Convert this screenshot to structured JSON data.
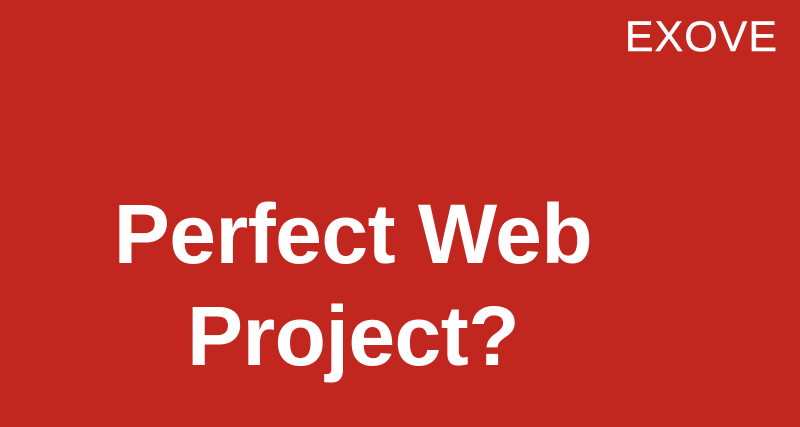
{
  "slide": {
    "background_color": "#c1271f",
    "text_color": "#ffffff",
    "logo_text": "EXOVE",
    "title_lines": [
      "Perfect Web",
      "Project?"
    ]
  }
}
